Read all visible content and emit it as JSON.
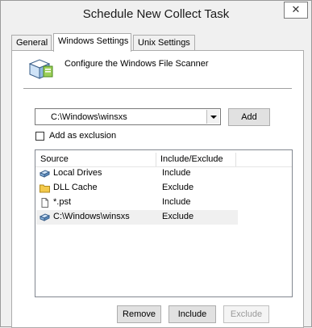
{
  "window": {
    "title": "Schedule New Collect Task",
    "close_glyph": "✕"
  },
  "tabs": [
    {
      "label": "General"
    },
    {
      "label": "Windows Settings"
    },
    {
      "label": "Unix Settings"
    }
  ],
  "header": {
    "icon": "file-scanner-icon",
    "text": "Configure the Windows File Scanner"
  },
  "path": {
    "value": "C:\\Windows\\winsxs",
    "add_label": "Add"
  },
  "exclusion": {
    "label": "Add as exclusion",
    "checked": false
  },
  "list": {
    "columns": [
      "Source",
      "Include/Exclude"
    ],
    "rows": [
      {
        "icon": "drive-icon",
        "source": "Local Drives",
        "mode": "Include"
      },
      {
        "icon": "folder-icon",
        "source": "DLL Cache",
        "mode": "Exclude"
      },
      {
        "icon": "file-icon",
        "source": "*.pst",
        "mode": "Include"
      },
      {
        "icon": "drive-icon",
        "source": "C:\\Windows\\winsxs",
        "mode": "Exclude"
      }
    ]
  },
  "actions": {
    "remove_label": "Remove",
    "include_label": "Include",
    "exclude_label": "Exclude"
  }
}
